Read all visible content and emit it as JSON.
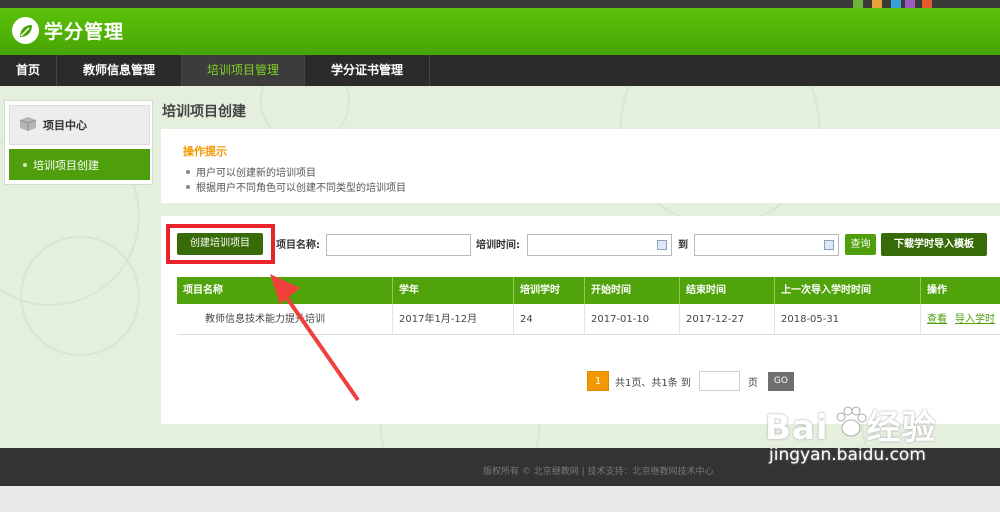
{
  "app": {
    "title": "学分管理"
  },
  "colors": {
    "brand_green": "#4f9e0b",
    "nav_dark": "#2b2b2b",
    "highlight_red": "#e8242a",
    "orange": "#f39800"
  },
  "top_strip_text": "",
  "nav": {
    "items": [
      {
        "label": "首页",
        "active": false
      },
      {
        "label": "教师信息管理",
        "active": false
      },
      {
        "label": "培训项目管理",
        "active": true
      },
      {
        "label": "学分证书管理",
        "active": false
      }
    ]
  },
  "sidebar": {
    "header": {
      "label": "项目中心",
      "icon": "box-icon"
    },
    "items": [
      {
        "label": "培训项目创建",
        "active": true
      }
    ]
  },
  "page": {
    "title": "培训项目创建"
  },
  "tips": {
    "title": "操作提示",
    "lines": [
      "用户可以创建新的培训项目",
      "根据用户不同角色可以创建不同类型的培训项目"
    ]
  },
  "toolbar": {
    "create_label": "创建培训项目",
    "name_label": "项目名称:",
    "name_value": "",
    "time_label": "培训时间:",
    "time_start": "",
    "time_to": "到",
    "time_end": "",
    "query_label": "查询",
    "download_label": "下载学时导入模板"
  },
  "table": {
    "headers": [
      "项目名称",
      "学年",
      "培训学时",
      "开始时间",
      "结束时间",
      "上一次导入学时时间",
      "操作"
    ],
    "rows": [
      {
        "name": "教师信息技术能力提升培训",
        "year": "2017年1月-12月",
        "hours": "24",
        "start": "2017-01-10",
        "end": "2017-12-27",
        "last_import": "2018-05-31",
        "actions": [
          "查看",
          "导入学时"
        ]
      }
    ]
  },
  "pager": {
    "current": "1",
    "summary": "共1页、共1条 到",
    "goto_value": "",
    "page_suffix": "页",
    "go_label": "GO"
  },
  "footer": {
    "text": "版权所有 © 北京继教网 | 技术支持：北京继教网技术中心"
  },
  "watermark": {
    "brand": "Bai",
    "brand2": "经验",
    "url": "jingyan.baidu.com"
  }
}
